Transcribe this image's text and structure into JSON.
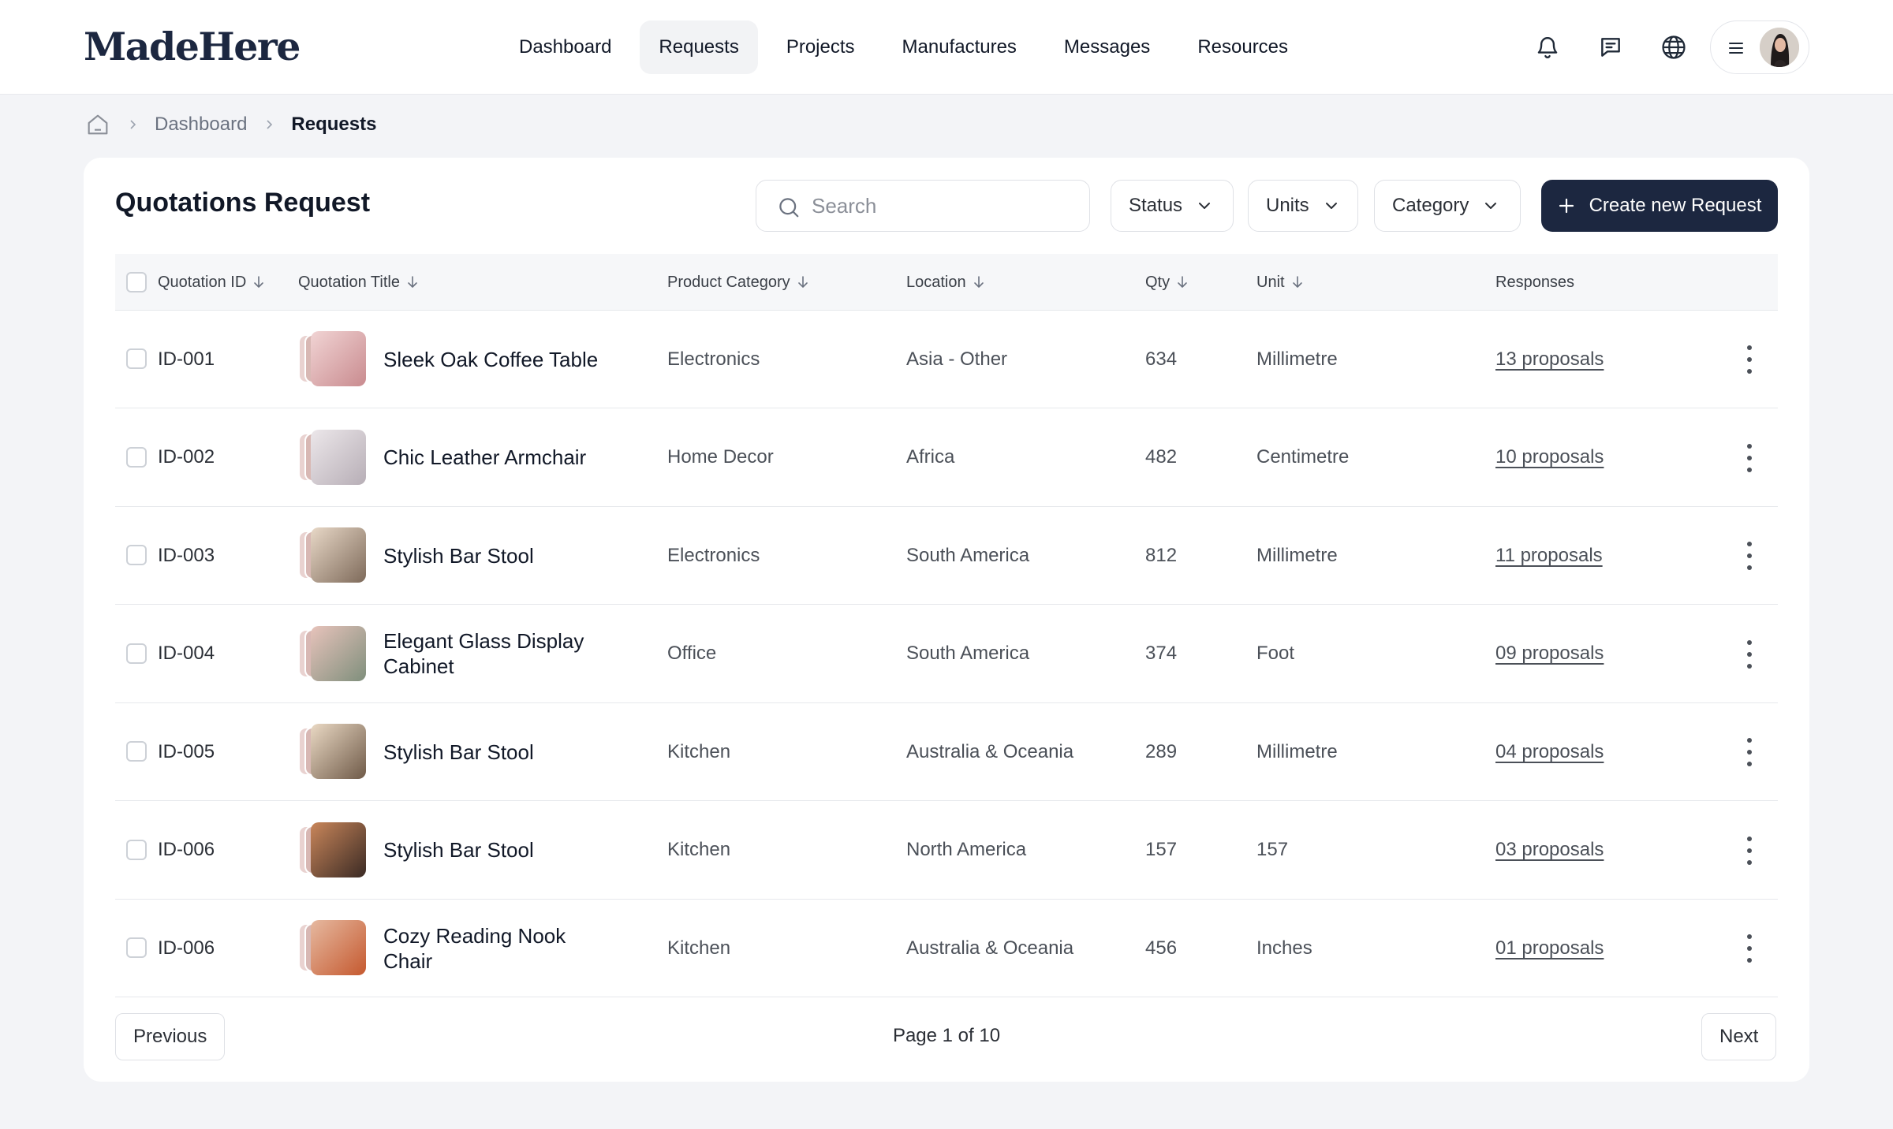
{
  "brand": {
    "logo": "MadeHere"
  },
  "nav": {
    "items": [
      {
        "label": "Dashboard",
        "active": false
      },
      {
        "label": "Requests",
        "active": true
      },
      {
        "label": "Projects",
        "active": false
      },
      {
        "label": "Manufactures",
        "active": false
      },
      {
        "label": "Messages",
        "active": false
      },
      {
        "label": "Resources",
        "active": false
      }
    ],
    "icons": [
      "bell-icon",
      "chat-icon",
      "globe-icon",
      "menu-icon"
    ]
  },
  "breadcrumb": {
    "home_icon": "home-icon",
    "items": [
      "Dashboard"
    ],
    "current": "Requests"
  },
  "card": {
    "title": "Quotations Request",
    "search": {
      "placeholder": "Search",
      "value": ""
    },
    "filters": {
      "status": "Status",
      "units": "Units",
      "category": "Category"
    },
    "create_button": "Create new Request"
  },
  "table": {
    "columns": {
      "id": "Quotation ID",
      "title": "Quotation Title",
      "category": "Product Category",
      "location": "Location",
      "qty": "Qty",
      "unit": "Unit",
      "responses": "Responses"
    },
    "rows": [
      {
        "id": "ID-001",
        "title": "Sleek Oak Coffee Table",
        "category": "Electronics",
        "location": "Asia - Other",
        "qty": "634",
        "unit": "Millimetre",
        "responses": "13 proposals"
      },
      {
        "id": "ID-002",
        "title": "Chic Leather Armchair",
        "category": "Home Decor",
        "location": "Africa",
        "qty": "482",
        "unit": "Centimetre",
        "responses": "10 proposals"
      },
      {
        "id": "ID-003",
        "title": "Stylish Bar Stool",
        "category": "Electronics",
        "location": "South America",
        "qty": "812",
        "unit": "Millimetre",
        "responses": "11 proposals"
      },
      {
        "id": "ID-004",
        "title": "Elegant Glass Display Cabinet",
        "category": "Office",
        "location": "South America",
        "qty": "374",
        "unit": "Foot",
        "responses": "09 proposals"
      },
      {
        "id": "ID-005",
        "title": "Stylish Bar Stool",
        "category": "Kitchen",
        "location": "Australia & Oceania",
        "qty": "289",
        "unit": "Millimetre",
        "responses": "04 proposals"
      },
      {
        "id": "ID-006",
        "title": "Stylish Bar Stool",
        "category": "Kitchen",
        "location": "North America",
        "qty": "157",
        "unit": "157",
        "responses": "03 proposals"
      },
      {
        "id": "ID-006",
        "title": "Cozy Reading Nook Chair",
        "category": "Kitchen",
        "location": "Australia & Oceania",
        "qty": "456",
        "unit": "Inches",
        "responses": "01 proposals"
      }
    ]
  },
  "pagination": {
    "previous": "Previous",
    "info": "Page 1 of 10",
    "next": "Next"
  },
  "colors": {
    "primary": "#1c2740",
    "background": "#f3f4f7",
    "surface": "#ffffff",
    "border": "#e6e8ec"
  }
}
